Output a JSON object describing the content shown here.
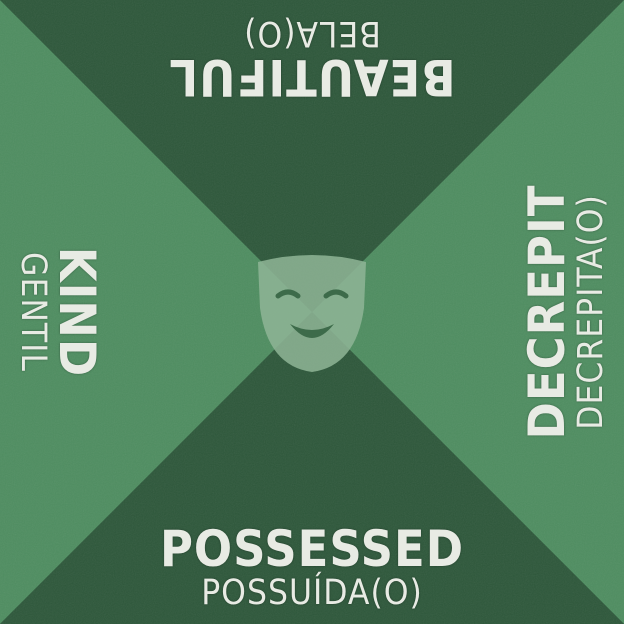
{
  "card": {
    "colors": {
      "light_triangle": "#4e8d60",
      "dark_triangle": "#2d573a",
      "text": "#e8ebe4",
      "mask": "#8fb597"
    },
    "center_icon": "comedy-mask-icon",
    "sides": {
      "bottom": {
        "primary": "POSSESSED",
        "secondary": "POSSUÍDA(O)"
      },
      "top": {
        "primary": "BEAUTIFUL",
        "secondary": "BELA(O)"
      },
      "left": {
        "primary": "KIND",
        "secondary": "GENTIL"
      },
      "right": {
        "primary": "DECREPIT",
        "secondary": "DECREPITA(O)"
      }
    }
  }
}
